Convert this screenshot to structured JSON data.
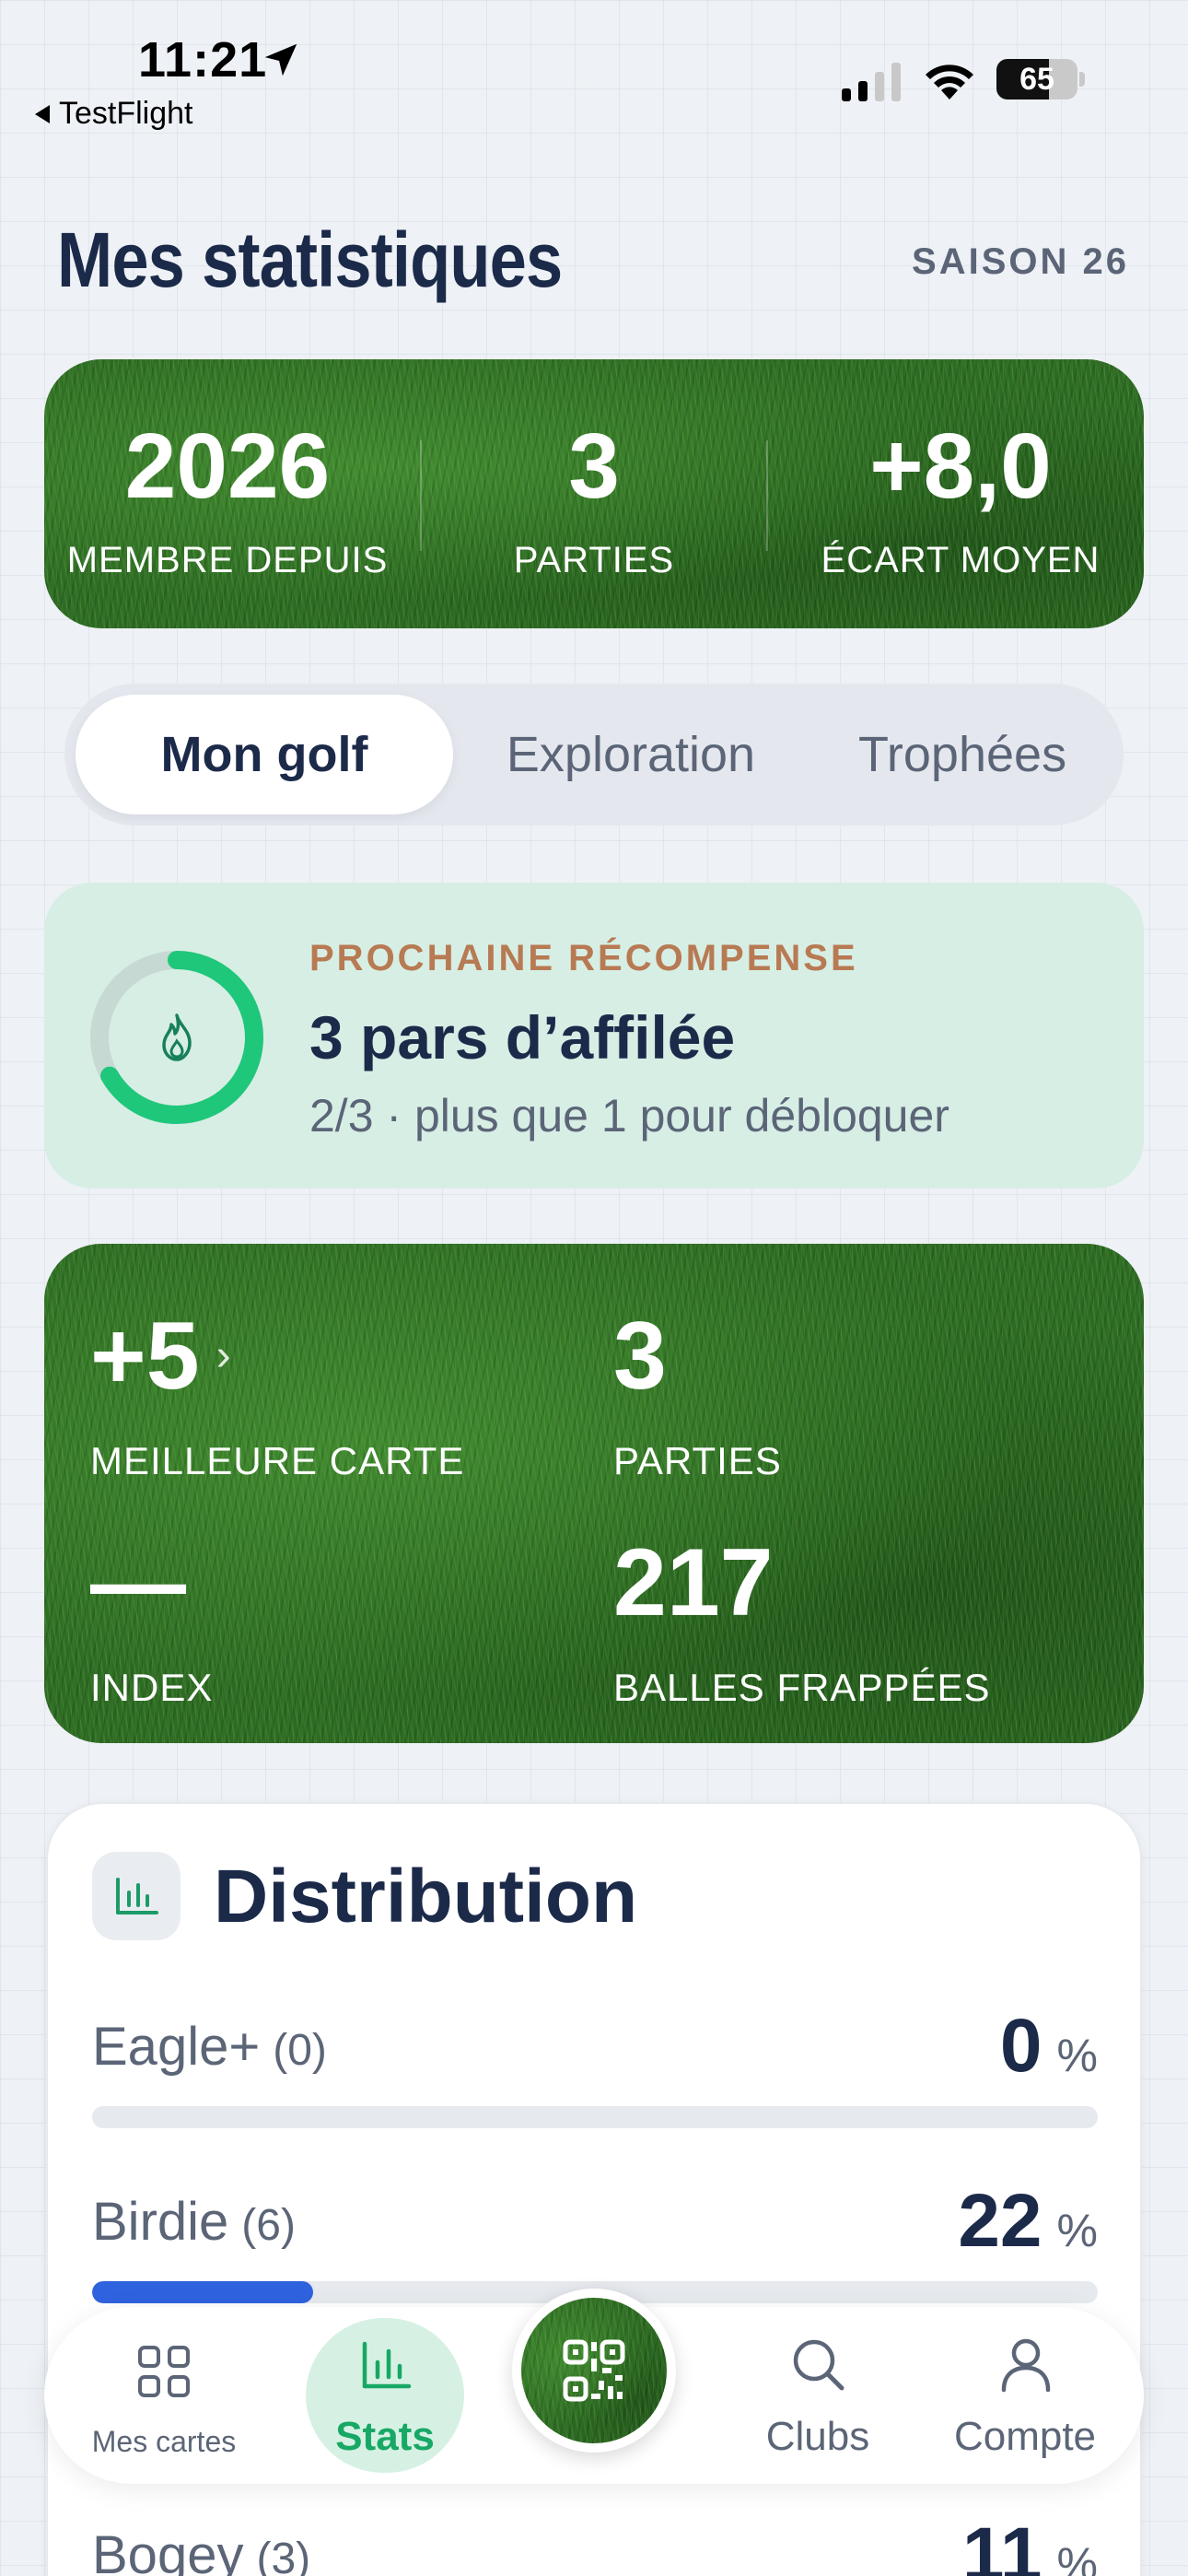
{
  "status_bar": {
    "time": "11:21",
    "back_label": "TestFlight",
    "battery": "65",
    "battery_level": 0.65
  },
  "header": {
    "title": "Mes statistiques",
    "season": "SAISON 26"
  },
  "summary": [
    {
      "value": "2026",
      "label": "MEMBRE DEPUIS"
    },
    {
      "value": "3",
      "label": "PARTIES"
    },
    {
      "value": "+8,0",
      "label": "ÉCART MOYEN"
    }
  ],
  "tabs": [
    {
      "label": "Mon golf",
      "active": true
    },
    {
      "label": "Exploration",
      "active": false
    },
    {
      "label": "Trophées",
      "active": false
    }
  ],
  "reward": {
    "kicker": "PROCHAINE RÉCOMPENSE",
    "title": "3 pars d’affilée",
    "subtitle": "2/3 · plus que 1 pour débloquer",
    "progress": 0.667,
    "icon": "flame-icon"
  },
  "stats": {
    "best_card": {
      "value": "+5",
      "chevron": "›",
      "label": "MEILLEURE CARTE"
    },
    "rounds": {
      "value": "3",
      "label": "PARTIES"
    },
    "index": {
      "value": "—",
      "label": "INDEX"
    },
    "balls": {
      "value": "217",
      "label": "BALLES FRAPPÉES"
    }
  },
  "distribution": {
    "heading": "Distribution",
    "icon": "bar-chart-icon",
    "rows": [
      {
        "name": "Eagle+",
        "count": "(0)",
        "percent": "0",
        "unit": "%",
        "fraction": 0.0
      },
      {
        "name": "Birdie",
        "count": "(6)",
        "percent": "22",
        "unit": "%",
        "fraction": 0.22
      },
      {
        "name": "Bogey",
        "count": "(3)",
        "percent": "11",
        "unit": "%",
        "fraction": 0.11
      }
    ]
  },
  "nav": {
    "cards": "Mes cartes",
    "stats": "Stats",
    "clubs": "Clubs",
    "account": "Compte",
    "active": "stats"
  },
  "colors": {
    "navy": "#1c2a4a",
    "muted": "#5b6577",
    "accent_green": "#1fc77a",
    "bar_blue": "#2f62de",
    "reward_bg": "#d7eee5",
    "reward_kicker": "#b77a52"
  }
}
